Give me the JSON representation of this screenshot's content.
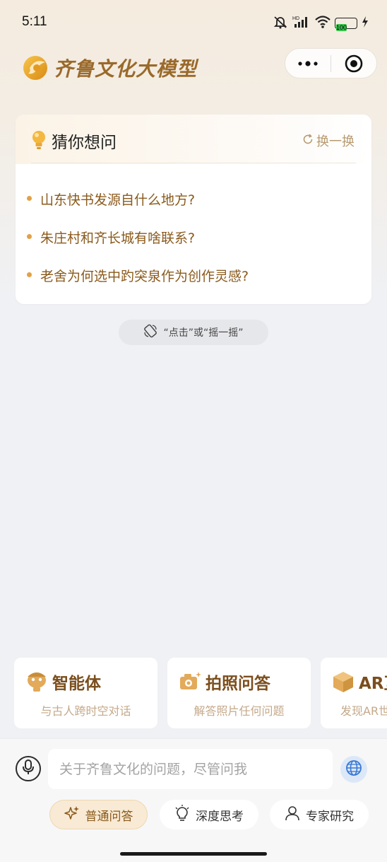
{
  "status_bar": {
    "time": "5:11",
    "battery": "100",
    "icons": [
      "dnd-icon",
      "hd-signal-icon",
      "wifi-icon",
      "battery-icon",
      "charging-icon"
    ]
  },
  "header": {
    "app_name": "齐鲁文化大模型",
    "more_icon": "more-dots-icon",
    "close_icon": "target-circle-icon"
  },
  "suggestions": {
    "title": "猜你想问",
    "refresh_label": "换一换",
    "questions": [
      "山东快书发源自什么地方?",
      "朱庄村和齐长城有啥联系?",
      "老舍为何选中趵突泉作为创作灵感?"
    ]
  },
  "shake_hint": "“点击”或“摇一摇”",
  "features": [
    {
      "title": "智能体",
      "subtitle": "与古人跨时空对话",
      "icon": "robot-icon"
    },
    {
      "title": "拍照问答",
      "subtitle": "解答照片任何问题",
      "icon": "camera-icon"
    },
    {
      "title": "AR互",
      "subtitle": "发现AR世",
      "icon": "box-icon"
    }
  ],
  "input": {
    "placeholder": "关于齐鲁文化的问题，尽管问我"
  },
  "modes": [
    {
      "label": "普通问答",
      "icon": "sparkle-icon",
      "active": true
    },
    {
      "label": "深度思考",
      "icon": "bulb-icon",
      "active": false
    },
    {
      "label": "专家研究",
      "icon": "person-icon",
      "active": false
    }
  ],
  "colors": {
    "brand_gold": "#9a6a2b",
    "question_text": "#8a5a1c",
    "bullet": "#e2a145",
    "active_mode_bg": "#f8ead4"
  }
}
